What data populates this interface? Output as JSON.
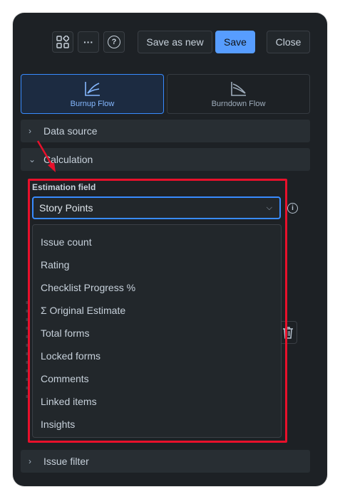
{
  "toolbar": {
    "apps_icon": "apps-icon",
    "more_label": "···",
    "help_label": "?",
    "save_as_new_label": "Save as new",
    "save_label": "Save",
    "close_label": "Close"
  },
  "chart_types": [
    {
      "label": "Burnup Flow",
      "icon": "burnup-icon",
      "selected": true
    },
    {
      "label": "Burndown Flow",
      "icon": "burndown-icon",
      "selected": false
    }
  ],
  "sections": {
    "data_source": "Data source",
    "calculation": "Calculation",
    "issue_filter": "Issue filter"
  },
  "estimation": {
    "label": "Estimation field",
    "value": "Story Points",
    "options": [
      "Issue count",
      "Rating",
      "Checklist Progress %",
      "Σ Original Estimate",
      "Total forms",
      "Locked forms",
      "Comments",
      "Linked items",
      "Insights"
    ]
  },
  "colors": {
    "panel_bg": "#1d2125",
    "accent": "#579dff",
    "annotation": "#e8102b"
  }
}
